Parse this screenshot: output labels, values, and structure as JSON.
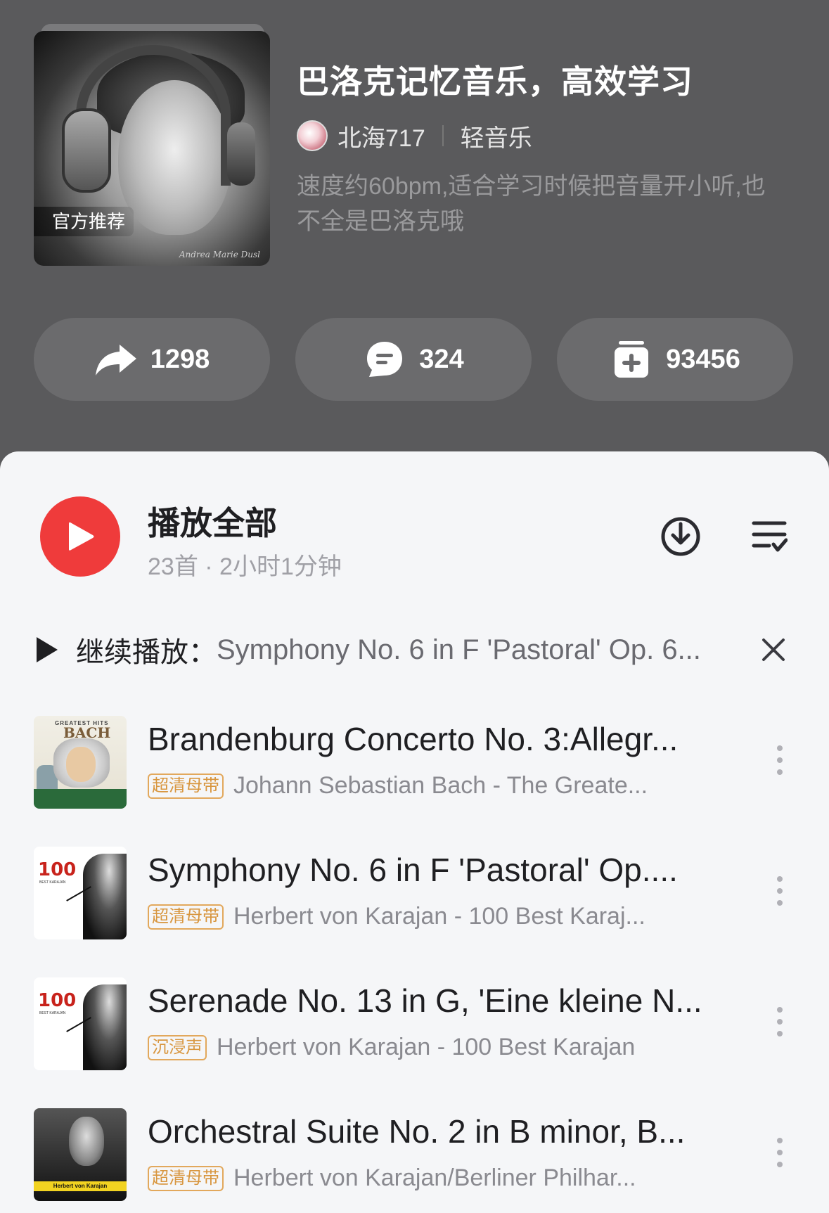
{
  "playlist": {
    "title": "巴洛克记忆音乐，高效学习",
    "badge": "官方推荐",
    "creator": "北海717",
    "genre": "轻音乐",
    "description": "速度约60bpm,适合学习时候把音量开小听,也不全是巴洛克哦",
    "cover_signature": "Andrea Marie Dusl"
  },
  "stats": {
    "share_count": "1298",
    "comment_count": "324",
    "collect_count": "93456"
  },
  "play_all": {
    "label": "播放全部",
    "meta": "23首 · 2小时1分钟"
  },
  "resume": {
    "label": "继续播放：",
    "song": "Symphony No. 6 in F 'Pastoral' Op. 6..."
  },
  "songs": [
    {
      "title": "Brandenburg Concerto No. 3:Allegr...",
      "quality": "超清母带",
      "artist": "Johann Sebastian Bach - The Greate...",
      "thumb_text": "GREATEST HITS",
      "thumb_title": "BACH"
    },
    {
      "title": "Symphony No. 6 in F 'Pastoral' Op....",
      "quality": "超清母带",
      "artist": "Herbert von Karajan - 100 Best Karaj...",
      "thumb_title": "100",
      "thumb_text": "BEST KARAJAN"
    },
    {
      "title": "Serenade No. 13 in G, 'Eine kleine N...",
      "quality": "沉浸声",
      "artist": "Herbert von Karajan - 100 Best Karajan",
      "thumb_title": "100",
      "thumb_text": "BEST KARAJAN"
    },
    {
      "title": "Orchestral Suite No. 2 in B minor, B...",
      "quality": "超清母带",
      "artist": "Herbert von Karajan/Berliner Philhar...",
      "thumb_text": "Herbert von Karajan"
    }
  ],
  "colors": {
    "header_bg": "#5a5a5c",
    "accent_red": "#ef3b3b",
    "quality_tag": "#d8963f"
  },
  "icons": [
    "share-icon",
    "comment-icon",
    "collect-icon",
    "play-icon",
    "download-icon",
    "multiselect-icon",
    "close-icon",
    "more-icon"
  ]
}
